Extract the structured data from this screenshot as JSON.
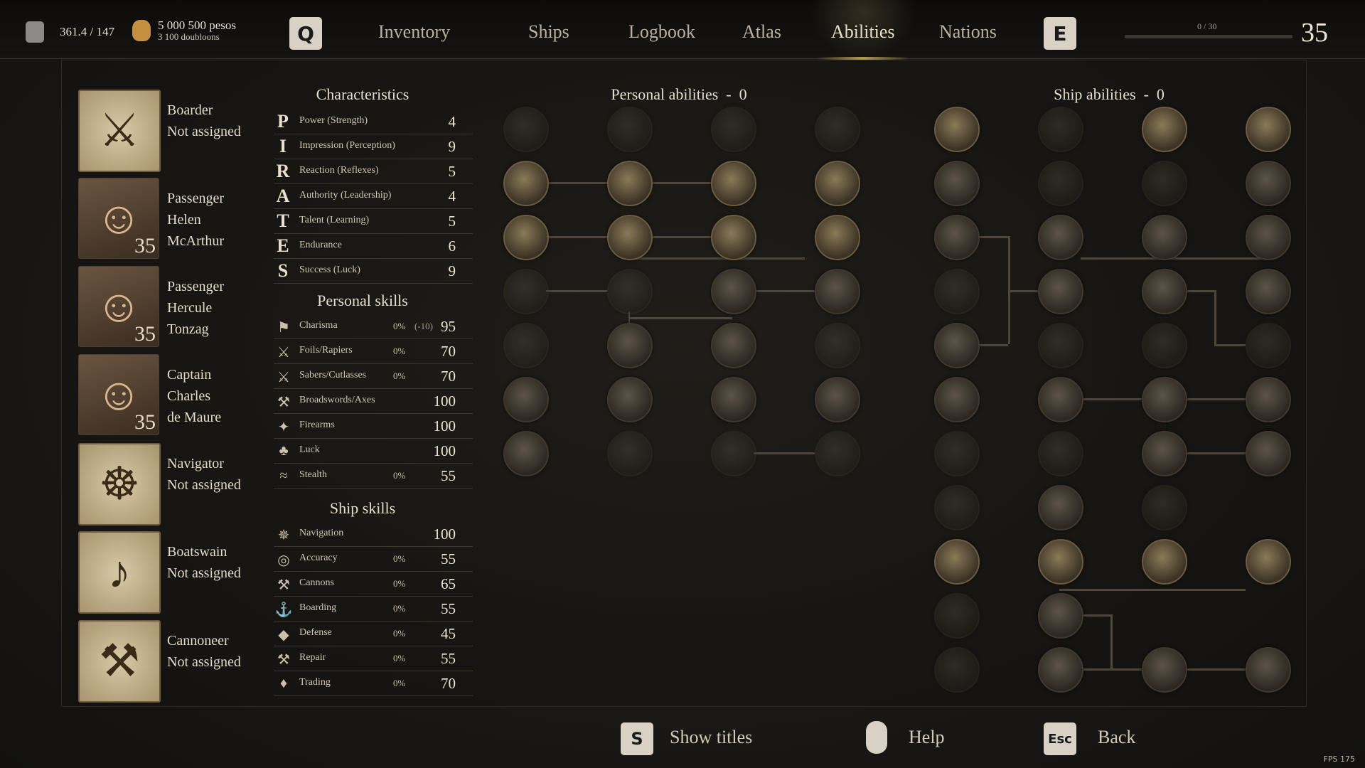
{
  "topbar": {
    "weight": "361.4 / 147",
    "pesos": "5 000 500 pesos",
    "doubloons": "3 100 doubloons",
    "key_left": "Q",
    "key_right": "E",
    "tabs": [
      "Inventory",
      "Ships",
      "Logbook",
      "Atlas",
      "Abilities",
      "Nations"
    ],
    "active_tab": "Abilities",
    "xp_text": "0 / 30",
    "xp_progress": 0,
    "level": "35"
  },
  "officers": [
    {
      "line1": "Boarder",
      "line2": "Not assigned",
      "line3": "",
      "icon": "crossed-swords-icon",
      "glyph": "⚔",
      "level": ""
    },
    {
      "line1": "Passenger",
      "line2": "Helen",
      "line3": "McArthur",
      "icon": "portrait-icon",
      "glyph": "☺",
      "level": "35"
    },
    {
      "line1": "Passenger",
      "line2": "Hercule",
      "line3": "Tonzag",
      "icon": "portrait-icon",
      "glyph": "☺",
      "level": "35"
    },
    {
      "line1": "Captain",
      "line2": "Charles",
      "line3": "de Maure",
      "icon": "portrait-icon",
      "glyph": "☺",
      "level": "35"
    },
    {
      "line1": "Navigator",
      "line2": "Not assigned",
      "line3": "",
      "icon": "ship-wheel-icon",
      "glyph": "☸",
      "level": ""
    },
    {
      "line1": "Boatswain",
      "line2": "Not assigned",
      "line3": "",
      "icon": "horn-icon",
      "glyph": "♪",
      "level": ""
    },
    {
      "line1": "Cannoneer",
      "line2": "Not assigned",
      "line3": "",
      "icon": "cannon-icon",
      "glyph": "⚒",
      "level": ""
    }
  ],
  "characteristics": {
    "title": "Characteristics",
    "items": [
      {
        "letter": "P",
        "label": "Power (Strength)",
        "value": "4"
      },
      {
        "letter": "I",
        "label": "Impression (Perception)",
        "value": "9"
      },
      {
        "letter": "R",
        "label": "Reaction (Reflexes)",
        "value": "5"
      },
      {
        "letter": "A",
        "label": "Authority (Leadership)",
        "value": "4"
      },
      {
        "letter": "T",
        "label": "Talent (Learning)",
        "value": "5"
      },
      {
        "letter": "E",
        "label": "Endurance",
        "value": "6"
      },
      {
        "letter": "S",
        "label": "Success (Luck)",
        "value": "9"
      }
    ]
  },
  "personal_skills": {
    "title": "Personal skills",
    "items": [
      {
        "icon": "red-flag-icon",
        "glyph": "⚑",
        "label": "Charisma",
        "pct": "0%",
        "mod": "(-10)",
        "value": "95"
      },
      {
        "icon": "rapier-icon",
        "glyph": "⚔",
        "label": "Foils/Rapiers",
        "pct": "0%",
        "mod": "",
        "value": "70"
      },
      {
        "icon": "saber-icon",
        "glyph": "⚔",
        "label": "Sabers/Cutlasses",
        "pct": "0%",
        "mod": "",
        "value": "70"
      },
      {
        "icon": "axe-icon",
        "glyph": "⚒",
        "label": "Broadswords/Axes",
        "pct": "",
        "mod": "",
        "value": "100"
      },
      {
        "icon": "pistol-icon",
        "glyph": "✦",
        "label": "Firearms",
        "pct": "",
        "mod": "",
        "value": "100"
      },
      {
        "icon": "clover-icon",
        "glyph": "♣",
        "label": "Luck",
        "pct": "",
        "mod": "",
        "value": "100"
      },
      {
        "icon": "stealth-icon",
        "glyph": "≈",
        "label": "Stealth",
        "pct": "0%",
        "mod": "",
        "value": "55"
      }
    ]
  },
  "ship_skills": {
    "title": "Ship skills",
    "items": [
      {
        "icon": "compass-icon",
        "glyph": "✵",
        "label": "Navigation",
        "pct": "",
        "mod": "",
        "value": "100"
      },
      {
        "icon": "target-icon",
        "glyph": "◎",
        "label": "Accuracy",
        "pct": "0%",
        "mod": "",
        "value": "55"
      },
      {
        "icon": "cannon-icon",
        "glyph": "⚒",
        "label": "Cannons",
        "pct": "0%",
        "mod": "",
        "value": "65"
      },
      {
        "icon": "grapple-icon",
        "glyph": "⚓",
        "label": "Boarding",
        "pct": "0%",
        "mod": "",
        "value": "55"
      },
      {
        "icon": "shield-icon",
        "glyph": "◆",
        "label": "Defense",
        "pct": "0%",
        "mod": "",
        "value": "45"
      },
      {
        "icon": "hammer-icon",
        "glyph": "⚒",
        "label": "Repair",
        "pct": "0%",
        "mod": "",
        "value": "55"
      },
      {
        "icon": "money-bag-icon",
        "glyph": "♦",
        "label": "Trading",
        "pct": "0%",
        "mod": "",
        "value": "70"
      }
    ]
  },
  "personal_abilities": {
    "title": "Personal abilities",
    "count": "0"
  },
  "ship_abilities": {
    "title": "Ship abilities",
    "count": "0"
  },
  "bottom": {
    "show_titles_key": "S",
    "show_titles": "Show titles",
    "help": "Help",
    "back_key": "Esc",
    "back": "Back"
  },
  "fps": "FPS 175"
}
